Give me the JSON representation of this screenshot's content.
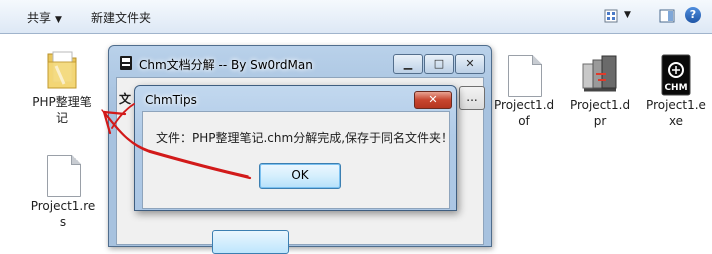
{
  "toolbar": {
    "share_label": "共享",
    "new_folder_label": "新建文件夹",
    "view_icon": "view-options-icon",
    "preview_icon": "preview-pane-icon",
    "help_icon": "help-icon",
    "help_glyph": "?"
  },
  "desktop_files": [
    {
      "label_line1": "PHP整理笔",
      "label_line2": "记",
      "icon": "folder-icon"
    },
    {
      "label_line1": "Project1.d",
      "label_line2": "of",
      "icon": "document-icon"
    },
    {
      "label_line1": "Project1.d",
      "label_line2": "pr",
      "icon": "project-icon"
    },
    {
      "label_line1": "Project1.e",
      "label_line2": "xe",
      "icon": "chm-exe-icon"
    },
    {
      "label_line1": "Project1.re",
      "label_line2": "s",
      "icon": "document-icon"
    }
  ],
  "chm_icon_text": "CHM",
  "app_window": {
    "title": "Chm文档分解 -- By Sw0rdMan",
    "label_partial": "文",
    "browse_label": "...",
    "minimize": "▁",
    "maximize": "□",
    "close": "✕"
  },
  "dialog": {
    "title": "ChmTips",
    "message": "文件：PHP整理笔记.chm分解完成,保存于同名文件夹！",
    "ok_label": "OK",
    "close_glyph": "✕"
  },
  "colors": {
    "annotation": "#d21a1a",
    "title_bar": "#b9d1ea",
    "ok_border": "#3c7fb1"
  }
}
